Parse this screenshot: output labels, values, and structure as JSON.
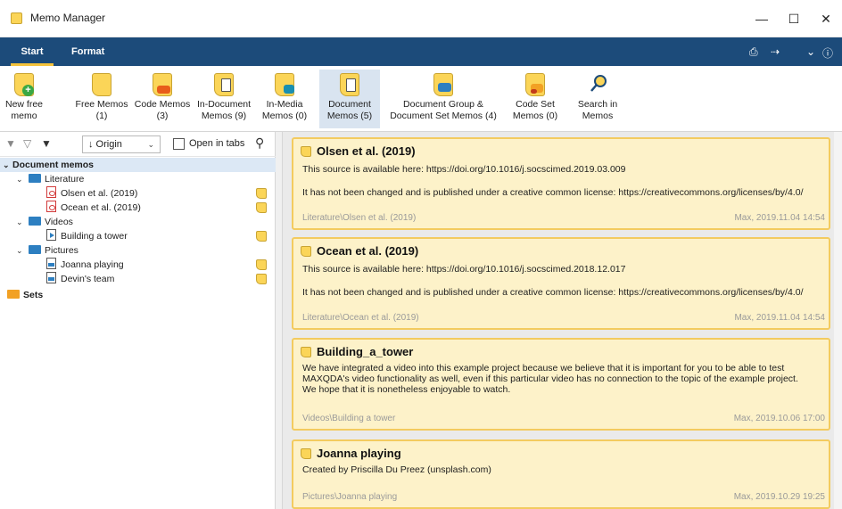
{
  "window": {
    "title": "Memo Manager",
    "controls": [
      "—",
      "☐",
      "✕"
    ]
  },
  "tabs": [
    {
      "label": "Start",
      "active": true
    },
    {
      "label": "Format",
      "active": false
    }
  ],
  "ribbon": {
    "buttons": [
      {
        "line1": "New free",
        "line2": "memo",
        "icon": "new-memo-icon"
      },
      {
        "line1": "Free Memos",
        "line2": "(1)",
        "icon": "free-memos-icon"
      },
      {
        "line1": "Code Memos",
        "line2": "(3)",
        "icon": "code-memos-icon"
      },
      {
        "line1": "In-Document",
        "line2": "Memos (9)",
        "icon": "in-document-memos-icon"
      },
      {
        "line1": "In-Media",
        "line2": "Memos (0)",
        "icon": "in-media-memos-icon"
      },
      {
        "line1": "Document",
        "line2": "Memos (5)",
        "icon": "document-memos-icon",
        "active": true
      },
      {
        "line1": "Document Group &",
        "line2": "Document Set Memos (4)",
        "icon": "document-group-memos-icon"
      },
      {
        "line1": "Code Set",
        "line2": "Memos (0)",
        "icon": "code-set-memos-icon"
      },
      {
        "line1": "Search in",
        "line2": "Memos",
        "icon": "search-memos-icon"
      }
    ]
  },
  "left_toolbar": {
    "sort_label": "↓ Origin",
    "open_in_tabs_label": "Open in tabs",
    "open_in_tabs_checked": false
  },
  "tree": {
    "root": "Document memos",
    "groups": [
      {
        "name": "Literature",
        "items": [
          "Olsen et al. (2019)",
          "Ocean et al. (2019)"
        ]
      },
      {
        "name": "Videos",
        "items": [
          "Building a tower"
        ]
      },
      {
        "name": "Pictures",
        "items": [
          "Joanna playing",
          "Devin's team"
        ]
      }
    ],
    "sets_label": "Sets"
  },
  "memos": [
    {
      "title": "Olsen et al. (2019)",
      "lines": [
        "This source is available here: https://doi.org/10.1016/j.socscimed.2019.03.009",
        "",
        "It has not been changed and is published under a creative common license: https://creativecommons.org/licenses/by/4.0/"
      ],
      "path": "Literature\\Olsen et al. (2019)",
      "meta": "Max, 2019.11.04 14:54"
    },
    {
      "title": "Ocean et al. (2019)",
      "lines": [
        "This source is available here: https://doi.org/10.1016/j.socscimed.2018.12.017",
        "",
        "It has not been changed and is published under a creative common license: https://creativecommons.org/licenses/by/4.0/"
      ],
      "path": "Literature\\Ocean et al. (2019)",
      "meta": "Max, 2019.11.04 14:54"
    },
    {
      "title": "Building_a_tower",
      "lines": [
        "We have integrated a video into this example project because we believe that it is important for you to be able to test",
        "MAXQDA's video functionality as well, even if this particular video has no connection to the topic of the example project.",
        "We hope that it is nonetheless enjoyable to watch."
      ],
      "path": "Videos\\Building a tower",
      "meta": "Max, 2019.10.06 17:00"
    },
    {
      "title": "Joanna playing",
      "lines": [
        "Created by Priscilla Du Preez (unsplash.com)"
      ],
      "path": "Pictures\\Joanna playing",
      "meta": "Max, 2019.10.29 19:25"
    }
  ],
  "colors": {
    "tabbar": "#1c4b7a",
    "memo_yellow": "#fbd558",
    "card_bg": "#fdf2c9",
    "card_border": "#f3cb5f",
    "active_ribbon": "#d9e4f0"
  }
}
